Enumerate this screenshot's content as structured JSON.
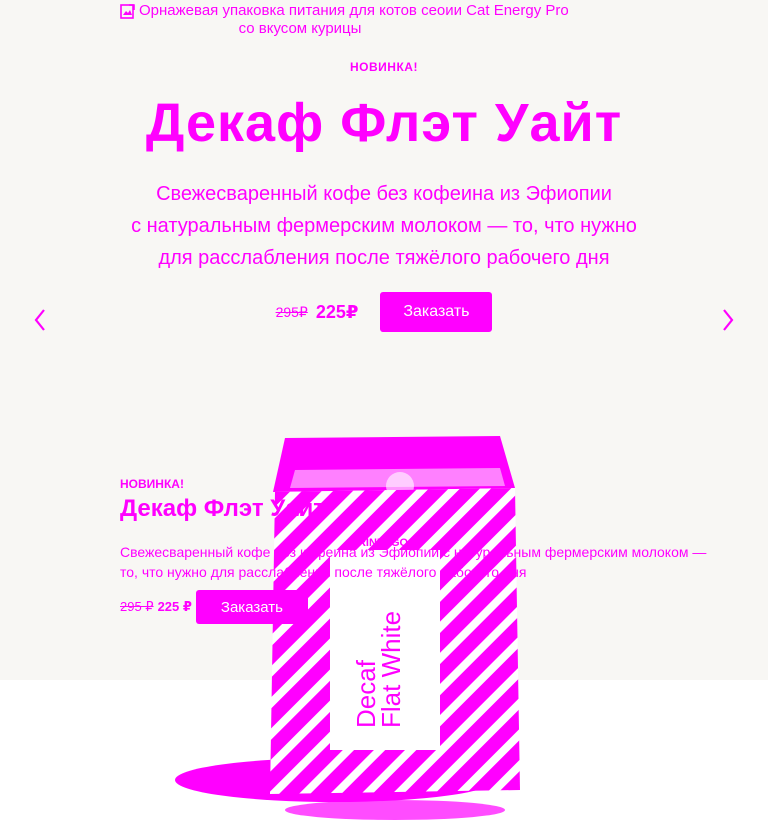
{
  "broken_image": {
    "alt_line1": "Орнажевая упаковка питания для котов сеоии Cat Energy Pro",
    "alt_line2": "со вкусом курицы"
  },
  "hero": {
    "badge": "НОВИНКА!",
    "title": "Декаф Флэт Уайт",
    "description_lines": [
      "Свежесваренный кофе без кофеина из Эфиопии",
      "с натуральным фермерским молоком — то, что нужно",
      "для расслабления после тяжёлого рабочего дня"
    ],
    "old_price": "295₽",
    "new_price": "225₽",
    "order_button": "Заказать"
  },
  "slider": {
    "prev_icon": "chevron-left-icon",
    "next_icon": "chevron-right-icon"
  },
  "second": {
    "badge": "НОВИНКА!",
    "title": "Декаф Флэт Уайт",
    "description": "Свежесваренный кофе без кофеина из Эфиопии с натуральным фермерским молоком — то, что нужно для расслабления после тяжёлого рабочего дня",
    "old_price": "295 ₽",
    "new_price": "225 ₽",
    "order_button": "Заказать"
  },
  "product_image": {
    "brand_text": "DRINK2GO",
    "label_line1": "Decaf",
    "label_line2": "Flat White"
  },
  "colors": {
    "accent": "#ff00ff",
    "hero_background": "#f8f7f4",
    "page_background": "#ffffff"
  }
}
